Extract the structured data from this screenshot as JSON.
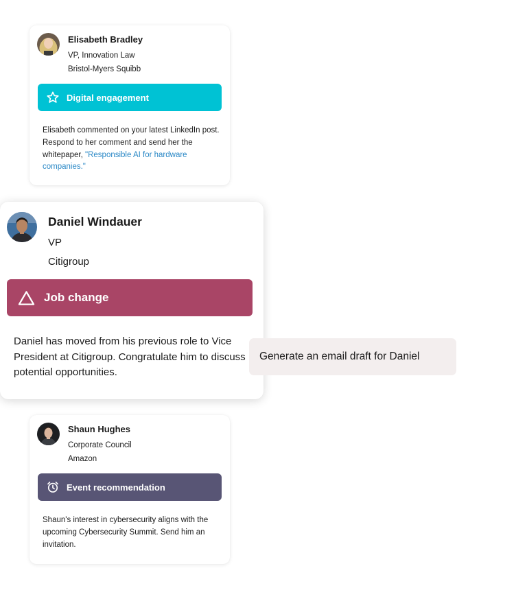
{
  "colors": {
    "digital_engagement": "#00c2d4",
    "job_change": "#a94566",
    "event_recommendation": "#585575",
    "link": "#2a88c6",
    "chip_background": "#f3eeee"
  },
  "cards": [
    {
      "name": "Elisabeth Bradley",
      "title": "VP, Innovation Law",
      "company": "Bristol-Myers Squibb",
      "banner": {
        "label": "Digital engagement",
        "icon": "star-icon"
      },
      "body": "Elisabeth commented on your latest LinkedIn post. Respond to her comment and send her the whitepaper, ",
      "body_link": "\"Responsible AI for hardware companies.\""
    },
    {
      "name": "Daniel Windauer",
      "title": "VP",
      "company": "Citigroup",
      "banner": {
        "label": "Job change",
        "icon": "triangle-icon"
      },
      "body": "Daniel has moved from his previous role to Vice President at Citigroup. Congratulate him to discuss potential opportunities."
    },
    {
      "name": "Shaun Hughes",
      "title": "Corporate Council",
      "company": "Amazon",
      "banner": {
        "label": "Event recommendation",
        "icon": "alarm-clock-icon"
      },
      "body": "Shaun's interest in cybersecurity aligns with the upcoming Cybersecurity Summit. Send him an invitation."
    }
  ],
  "prompt_suggestion": "Generate an email draft for Daniel"
}
